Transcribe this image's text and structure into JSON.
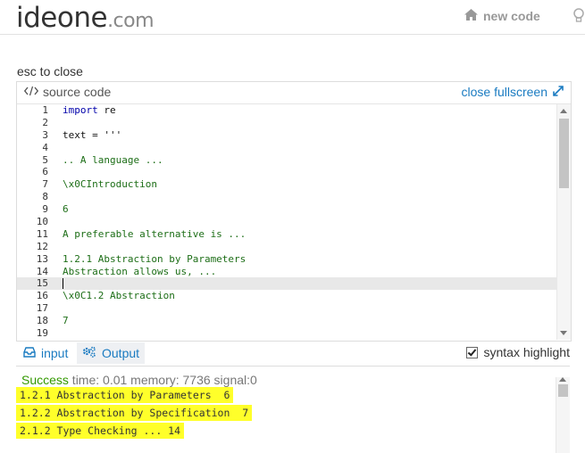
{
  "header": {
    "logo_main": "ideone",
    "logo_domain": ".com",
    "new_code_label": "new code"
  },
  "esc_hint": "esc to close",
  "editor": {
    "title": "source code",
    "close_fullscreen_label": "close fullscreen",
    "lines": [
      {
        "n": "1",
        "text": "import re",
        "style": "kw"
      },
      {
        "n": "2",
        "text": "",
        "style": "plain"
      },
      {
        "n": "3",
        "text": "text = '''",
        "style": "plain"
      },
      {
        "n": "4",
        "text": "",
        "style": "plain"
      },
      {
        "n": "5",
        "text": ".. A language ...",
        "style": "str"
      },
      {
        "n": "6",
        "text": "",
        "style": "plain"
      },
      {
        "n": "7",
        "text": "\\x0CIntroduction",
        "style": "str"
      },
      {
        "n": "8",
        "text": "",
        "style": "plain"
      },
      {
        "n": "9",
        "text": "6",
        "style": "str"
      },
      {
        "n": "10",
        "text": "",
        "style": "plain"
      },
      {
        "n": "11",
        "text": "A preferable alternative is ...",
        "style": "str"
      },
      {
        "n": "12",
        "text": "",
        "style": "plain"
      },
      {
        "n": "13",
        "text": "1.2.1 Abstraction by Parameters",
        "style": "str"
      },
      {
        "n": "14",
        "text": "Abstraction allows us, ...",
        "style": "str"
      },
      {
        "n": "15",
        "text": "",
        "style": "plain",
        "active": true
      },
      {
        "n": "16",
        "text": "\\x0C1.2 Abstraction",
        "style": "str"
      },
      {
        "n": "17",
        "text": "",
        "style": "plain"
      },
      {
        "n": "18",
        "text": "7",
        "style": "str"
      },
      {
        "n": "19",
        "text": "",
        "style": "plain"
      }
    ]
  },
  "tabs": {
    "input_label": "input",
    "output_label": "Output",
    "syntax_label": "syntax highlight",
    "syntax_checked": true
  },
  "output": {
    "status_success": "Success",
    "status_rest": " time: 0.01 memory: 7736 signal:0",
    "lines": [
      "1.2.1 Abstraction by Parameters  6",
      "1.2.2 Abstraction by Specification  7",
      "2.1.2 Type Checking ... 14"
    ],
    "highlight_color": "#ffff2a"
  },
  "colors": {
    "accent": "#1a7bc1",
    "success": "#339900"
  }
}
